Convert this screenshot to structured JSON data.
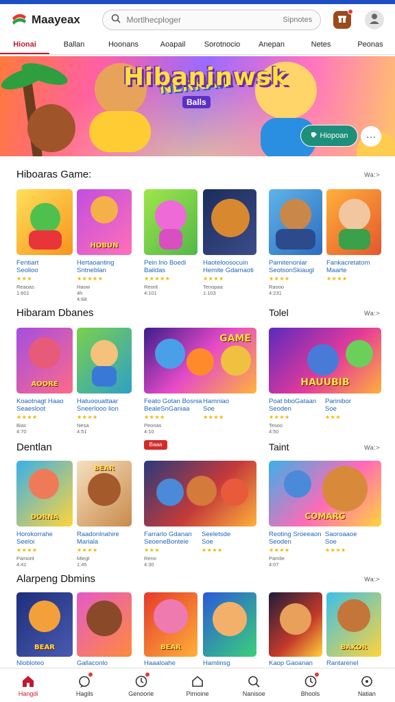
{
  "header": {
    "logo_text": "Maayeax",
    "search_placeholder": "Mortlhecploger",
    "search_right": "Sipnotes"
  },
  "tabs": [
    "Hionai",
    "Ballan",
    "Hoonans",
    "Aoapail",
    "Sorotnocio",
    "Anepan",
    "Netes",
    "Peonas"
  ],
  "banner": {
    "small_text": "NERKAIE",
    "sub_text": "Balls",
    "title": "Hibaninwsk",
    "cta_label": "Hiopoan",
    "more_symbol": "···"
  },
  "sections": [
    {
      "title": "Hiboaras Game:",
      "see_all": "Wa:>",
      "cards": [
        {
          "title": "Fentiart\nSeolioo",
          "stars": "★★★",
          "meta": "Reaoas 1:601"
        },
        {
          "title": "Hertaoanting\nSntneblan",
          "stars": "★★★★★",
          "meta": "Haow 4h 4:68"
        },
        {
          "title": "Pein lrio Boedi\nBaildas",
          "stars": "★★★★★",
          "meta": "Reorit 4:101"
        },
        {
          "title": "Haoteloosocuin\nHemite Gdamaoti",
          "stars": "★★★★",
          "meta": "Tenopaa 1:103"
        },
        {
          "title": "Pamitenoniar\nSeotsonSkiaugl",
          "stars": "★★★★",
          "meta": "Raooo 4:231"
        },
        {
          "title": "Fankacretatom\nMaarte",
          "stars": "★★★★",
          "meta": ""
        }
      ]
    },
    {
      "title": "Hibaram Dbanes",
      "right_title": "Tolel",
      "see_all": "Wa:>",
      "cards": [
        {
          "title": "Koaotnagt Haao\nSeaesloot",
          "stars": "★★★★",
          "meta": "Biac 4:70"
        },
        {
          "title": "Hatuoouattaar\nSneerlooo lion",
          "stars": "★★★★",
          "meta": "Nesa 4:51"
        },
        {
          "title": "Feato Gotan Bosnia\nBealeSnGaniaa",
          "stars": "★★★★",
          "meta": "Peonas 4:10"
        },
        {
          "title": "Hamniao\nSoe",
          "stars": "★★★★",
          "meta": ""
        },
        {
          "title": "Poat bboGataan\nSeoden",
          "stars": "★★★★",
          "meta": "Tesoo 4:50"
        },
        {
          "title": "Parinibor\nSoe",
          "stars": "★★★",
          "meta": ""
        }
      ]
    },
    {
      "title": "Dentlan",
      "right_title": "Taint",
      "see_all": "Wa:>",
      "badge": "Baaa",
      "cards": [
        {
          "title": "Horokorrahe\nSeeloi",
          "stars": "★★★★",
          "meta": "Pamorit 4:41"
        },
        {
          "title": "Raadonlnahire\nMariala",
          "stars": "★★★★",
          "meta": "Miegt 1:45"
        },
        {
          "title": "Farrarlo Gdanan\nSeoeneBonteie",
          "stars": "★★★",
          "meta": "Reno 4:30"
        },
        {
          "title": "Seeletsde\nSoe",
          "stars": "★★★★",
          "meta": ""
        },
        {
          "title": "Reoting Sroeeaon\nSeoden",
          "stars": "★★★★",
          "meta": "Pamlie 4:07"
        },
        {
          "title": "Saoroaaoe\nSoe",
          "stars": "★★★★",
          "meta": ""
        }
      ]
    },
    {
      "title": "Alarpeng Dbmins",
      "see_all": "Wa:>",
      "cards": [
        {
          "title": "Nlobloteo",
          "stars": "",
          "meta": ""
        },
        {
          "title": "Gallaconlo",
          "stars": "",
          "meta": ""
        },
        {
          "title": "Haaaloahe",
          "stars": "",
          "meta": ""
        },
        {
          "title": "Hamlinsg",
          "stars": "",
          "meta": ""
        },
        {
          "title": "Kaop Gaoanan",
          "stars": "",
          "meta": ""
        },
        {
          "title": "Rantarenel",
          "stars": "",
          "meta": ""
        }
      ]
    }
  ],
  "thumb_labels": [
    "",
    "HOBUN",
    "",
    "",
    "",
    "",
    "AOORE",
    "",
    "GAME",
    "HAUUBIB",
    "DORNA",
    "BEAR",
    "",
    "",
    "COMARG",
    "",
    "BEAR",
    "",
    "BEAR",
    "",
    "",
    "",
    "BAKOR",
    ""
  ],
  "bottom_nav": [
    {
      "label": "Hangdi",
      "icon": "home-icon"
    },
    {
      "label": "Hagils",
      "icon": "chat-icon"
    },
    {
      "label": "Genoorie",
      "icon": "clock-icon"
    },
    {
      "label": "Pirnoine",
      "icon": "house-outline-icon"
    },
    {
      "label": "Nanisoe",
      "icon": "search-icon"
    },
    {
      "label": "Bhools",
      "icon": "clock-icon"
    },
    {
      "label": "Natian",
      "icon": "chat-icon"
    }
  ],
  "colors": {
    "accent": "#c5162e",
    "link": "#1f66b8",
    "star": "#f3b400",
    "cta": "#1d8f7a"
  }
}
